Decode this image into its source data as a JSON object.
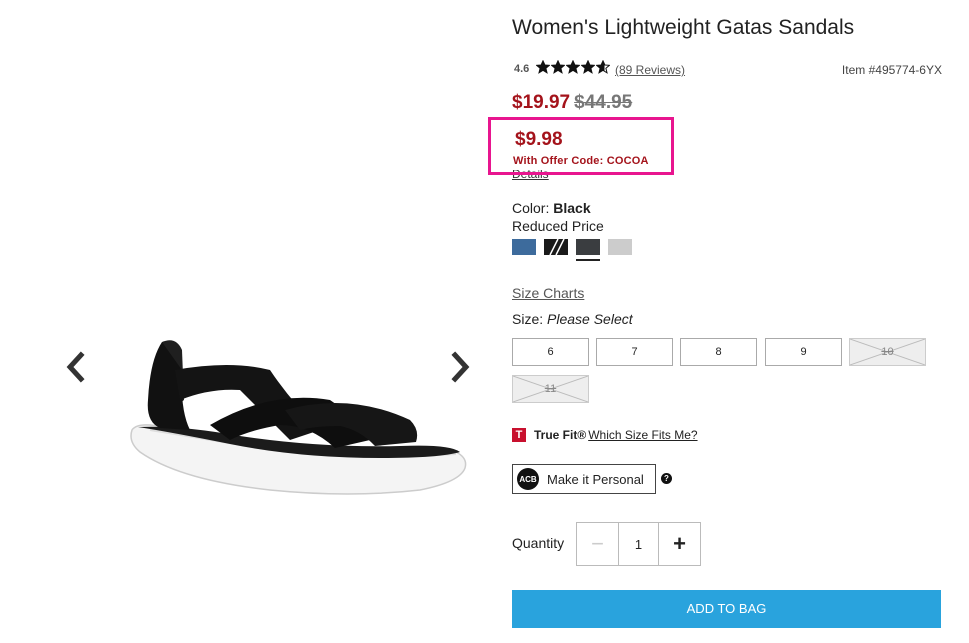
{
  "product": {
    "title": "Women's Lightweight Gatas Sandals",
    "rating": "4.6",
    "rating_value": 4.6,
    "rating_max": 5,
    "reviews_link": "(89 Reviews)",
    "item_number": "Item #495774-6YX"
  },
  "pricing": {
    "sale_price": "$19.97",
    "original_price": "$44.95",
    "offer_price": "$9.98",
    "offer_code_text": "With Offer Code: COCOA",
    "details_link": "Details",
    "highlight_color": "#e8158f",
    "price_color": "#a4131b"
  },
  "color": {
    "label": "Color:",
    "selected": "Black",
    "note": "Reduced Price",
    "swatches": [
      {
        "name": "blue",
        "color": "#3d6b9c"
      },
      {
        "name": "black-pattern",
        "color": "#1a1a1a"
      },
      {
        "name": "black",
        "color": "#3a3d40",
        "selected": true
      },
      {
        "name": "light-gray",
        "color": "#cccccc"
      }
    ]
  },
  "size": {
    "charts_link": "Size Charts",
    "label": "Size:",
    "prompt": "Please Select",
    "options": [
      {
        "label": "6",
        "available": true
      },
      {
        "label": "7",
        "available": true
      },
      {
        "label": "8",
        "available": true
      },
      {
        "label": "9",
        "available": true
      },
      {
        "label": "10",
        "available": false
      },
      {
        "label": "11",
        "available": false
      }
    ]
  },
  "truefit": {
    "logo": "T",
    "name": "True Fit®",
    "link": "Which Size Fits Me?"
  },
  "personalize": {
    "icon_text": "ACB",
    "label": "Make it Personal",
    "help": "?"
  },
  "quantity": {
    "label": "Quantity",
    "value": "1",
    "minus": "−",
    "plus": "+"
  },
  "cart": {
    "add_label": "ADD TO BAG",
    "button_color": "#29a3dd"
  },
  "icons": {
    "prev": "chevron-left-icon",
    "next": "chevron-right-icon",
    "star": "star-icon"
  }
}
